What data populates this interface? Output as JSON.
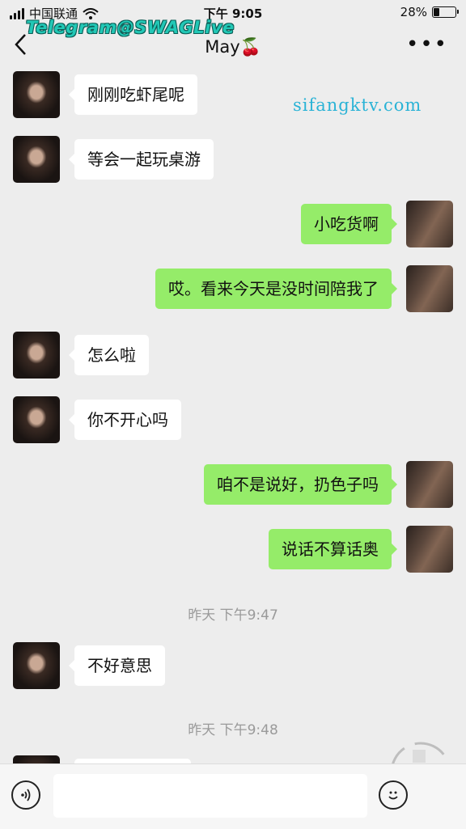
{
  "status": {
    "carrier": "中国联通",
    "time": "下午 9:05",
    "battery": "28%",
    "battery_level": 0.28
  },
  "overlay": {
    "telegram": "Telegram@SWAGLive",
    "site": "sifangktv.com"
  },
  "nav": {
    "back_icon": "chevron-left-icon",
    "title": "May🍒",
    "more_icon": "ellipsis-icon"
  },
  "messages": [
    {
      "side": "left",
      "text": "刚刚吃虾尾呢"
    },
    {
      "side": "left",
      "text": "等会一起玩桌游"
    },
    {
      "side": "right",
      "text": "小吃货啊"
    },
    {
      "side": "right",
      "text": "哎。看来今天是没时间陪我了"
    },
    {
      "side": "left",
      "text": "怎么啦"
    },
    {
      "side": "left",
      "text": "你不开心吗"
    },
    {
      "side": "right",
      "text": "咱不是说好，扔色子吗"
    },
    {
      "side": "right",
      "text": "说话不算话奥"
    },
    {
      "side": "left",
      "text": "不好意思"
    }
  ],
  "timestamps": [
    "昨天 下午9:47",
    "昨天 下午9:48"
  ],
  "input": {
    "voice_icon": "voice-icon",
    "placeholder": "",
    "emoji_icon": "emoji-icon"
  }
}
